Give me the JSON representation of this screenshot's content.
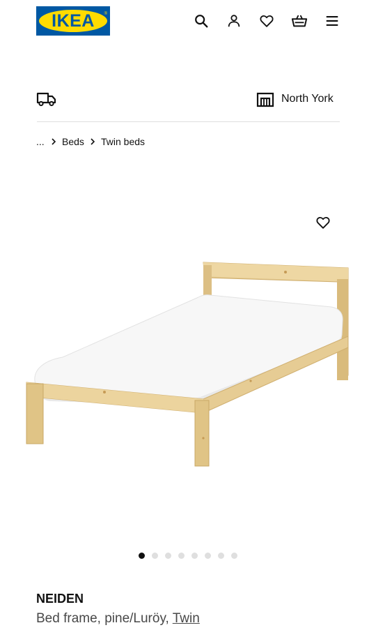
{
  "header": {
    "logo_text": "IKEA",
    "logo_reg": "®",
    "icons": [
      "search-icon",
      "user-icon",
      "heart-icon",
      "basket-icon",
      "menu-icon"
    ]
  },
  "location": {
    "delivery_icon": "truck-icon",
    "store_icon": "store-icon",
    "store_name": "North York"
  },
  "breadcrumb": {
    "items": [
      "...",
      "Beds",
      "Twin beds"
    ]
  },
  "gallery": {
    "image_alt": "bed-frame-product-image",
    "favorite_icon": "heart-icon",
    "slide_count": 8,
    "active_slide": 0
  },
  "product": {
    "name": "NEIDEN",
    "description": "Bed frame, pine/Luröy, ",
    "size_link": "Twin"
  },
  "colors": {
    "ikea_blue": "#0058a3",
    "ikea_yellow": "#ffdb00",
    "text": "#111111",
    "muted_text": "#484848"
  }
}
